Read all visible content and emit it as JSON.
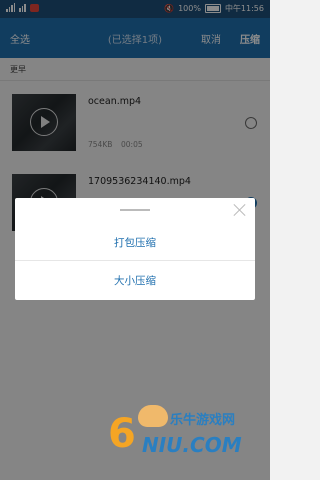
{
  "status_bar": {
    "battery": "100%",
    "time": "中午11:56"
  },
  "header": {
    "select_all": "全选",
    "selected_count": "(已选择1项)",
    "cancel": "取消",
    "compress": "压缩"
  },
  "section_label": "更早",
  "files": [
    {
      "name": "ocean.mp4",
      "size": "754KB",
      "duration": "00:05",
      "selected": false
    },
    {
      "name": "1709536234140.mp4",
      "size": "",
      "duration": "",
      "selected": true
    }
  ],
  "sheet": {
    "options": [
      "打包压缩",
      "大小压缩"
    ]
  },
  "watermark": {
    "cn": "乐牛游戏网",
    "en": "NIU.COM",
    "num": "6"
  },
  "colors": {
    "header": "#1f6fae",
    "status_bar": "#1e4f78",
    "accent": "#1f6fae"
  }
}
